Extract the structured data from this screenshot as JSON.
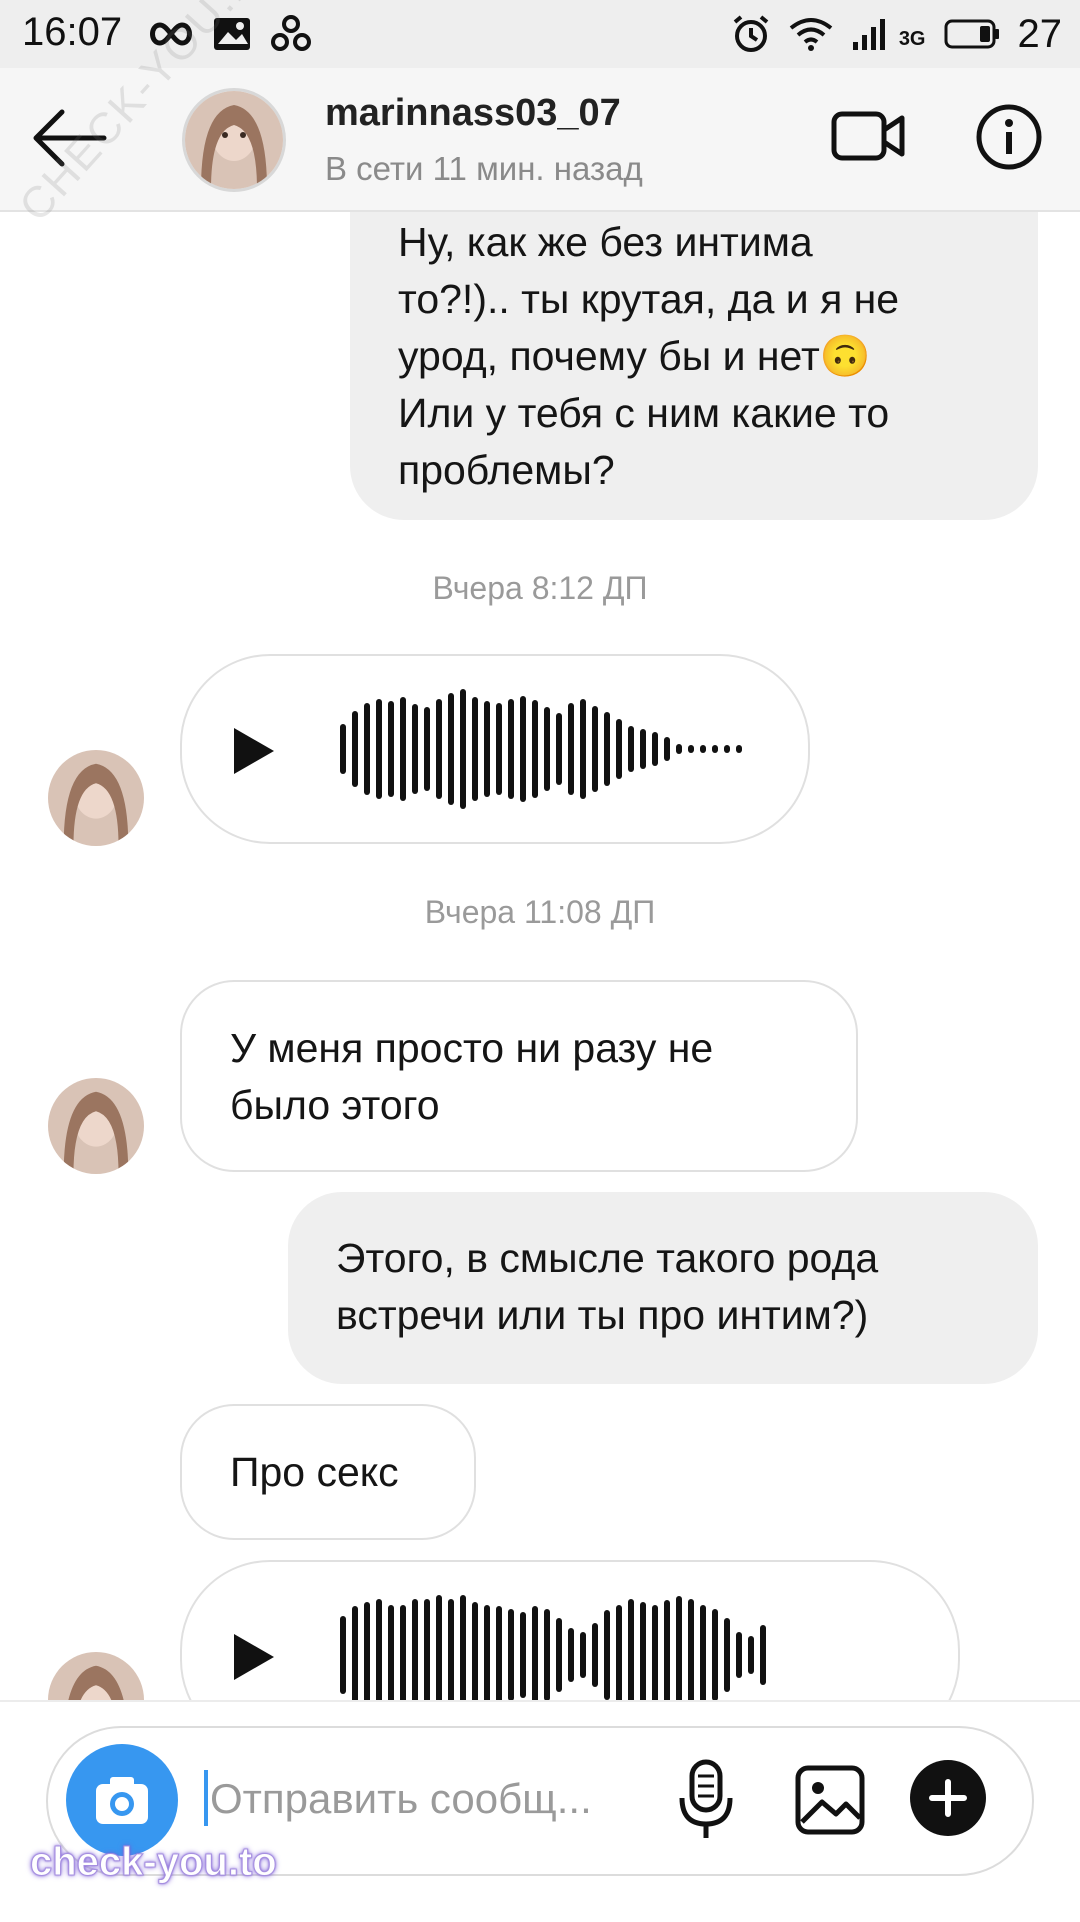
{
  "status_bar": {
    "time": "16:07",
    "network": "3G",
    "battery_level": "27"
  },
  "header": {
    "username": "marinnass03_07",
    "presence": "В сети 11 мин. назад"
  },
  "messages": [
    {
      "direction": "outgoing",
      "type": "text",
      "text": "Ну, как же без интима\nто?!).. ты крутая, да и я не\nурод, почему бы и нет🙃\nИли у тебя с ним какие то\nпроблемы?"
    },
    {
      "type": "timestamp",
      "text": "Вчера 8:12 ДП"
    },
    {
      "direction": "incoming",
      "type": "voice"
    },
    {
      "type": "timestamp",
      "text": "Вчера 11:08 ДП"
    },
    {
      "direction": "incoming",
      "type": "text",
      "text": "У меня просто ни разу не\nбыло этого"
    },
    {
      "direction": "outgoing",
      "type": "text",
      "text": "Этого, в смысле такого рода\nвстречи или ты про интим?)"
    },
    {
      "direction": "incoming",
      "type": "text",
      "text": "Про секс"
    },
    {
      "direction": "incoming",
      "type": "voice"
    }
  ],
  "composer": {
    "placeholder": "Отправить сообщ..."
  },
  "watermarks": {
    "bottom": "check-you.to",
    "diagonal": "CHECK-YOU.ME"
  },
  "colors": {
    "accent": "#3797f0",
    "outgoing_bubble": "#efefef",
    "header_bg": "#f6f6f6"
  },
  "icons": [
    "arrow-left-icon",
    "video-camera-icon",
    "info-icon",
    "play-icon",
    "camera-icon",
    "microphone-icon",
    "gallery-icon",
    "plus-icon"
  ]
}
